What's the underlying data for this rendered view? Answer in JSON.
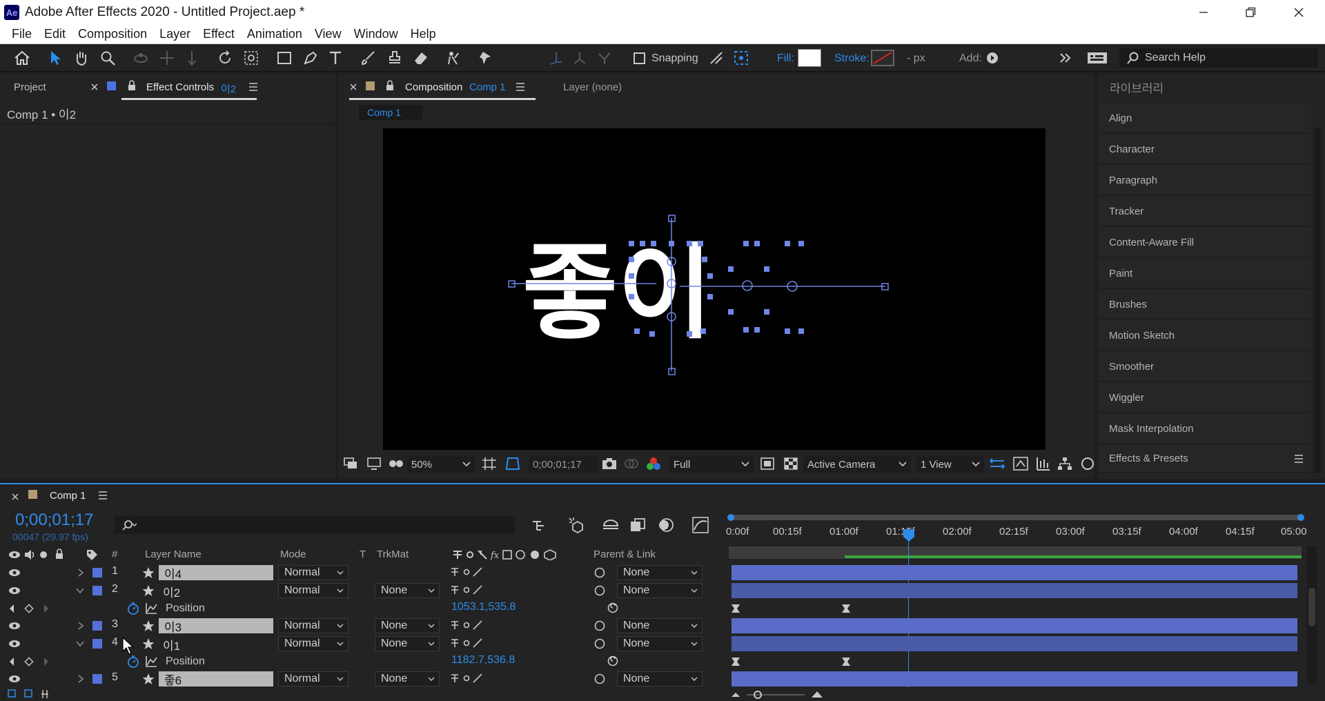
{
  "window": {
    "title": "Adobe After Effects 2020 - Untitled Project.aep *",
    "app_badge": "Ae"
  },
  "menu": [
    "File",
    "Edit",
    "Composition",
    "Layer",
    "Effect",
    "Animation",
    "View",
    "Window",
    "Help"
  ],
  "toolbar": {
    "snapping": "Snapping",
    "fill": "Fill:",
    "stroke": "Stroke:",
    "px": "- px",
    "add": "Add:",
    "search_placeholder": "Search Help"
  },
  "left_panel": {
    "tab_project": "Project",
    "tab_effect_controls": "Effect Controls",
    "effect_target": "이2",
    "breadcrumb": "Comp 1 • 이2"
  },
  "comp_panel": {
    "tab_label": "Composition",
    "comp_name": "Comp 1",
    "layer_tab": "Layer (none)",
    "sub_tab": "Comp 1",
    "viewer_text": "좋이",
    "zoom": "50%",
    "timecode": "0;00;01;17",
    "resolution": "Full",
    "camera": "Active Camera",
    "views": "1 View"
  },
  "right_panel": {
    "library": "라이브러리",
    "items": [
      "Align",
      "Character",
      "Paragraph",
      "Tracker",
      "Content-Aware Fill",
      "Paint",
      "Brushes",
      "Motion Sketch",
      "Smoother",
      "Wiggler",
      "Mask Interpolation",
      "Effects & Presets"
    ]
  },
  "timeline": {
    "tab_label": "Comp 1",
    "timecode": "0;00;01;17",
    "frame_info": "00047 (29.97 fps)",
    "columns": {
      "num": "#",
      "layer_name": "Layer Name",
      "mode": "Mode",
      "t": "T",
      "trkmat": "TrkMat",
      "parent": "Parent & Link"
    },
    "ruler": [
      "0:00f",
      "00:15f",
      "01:00f",
      "01:15f",
      "02:00f",
      "02:15f",
      "03:00f",
      "03:15f",
      "04:00f",
      "04:15f",
      "05:00"
    ],
    "layers": [
      {
        "num": "1",
        "name": "이4",
        "mode": "Normal",
        "trkmat": "",
        "parent": "None"
      },
      {
        "num": "2",
        "name": "이2",
        "mode": "Normal",
        "trkmat": "None",
        "parent": "None"
      },
      {
        "num": "3",
        "name": "이3",
        "mode": "Normal",
        "trkmat": "None",
        "parent": "None"
      },
      {
        "num": "4",
        "name": "이1",
        "mode": "Normal",
        "trkmat": "None",
        "parent": "None"
      },
      {
        "num": "5",
        "name": "좋6",
        "mode": "Normal",
        "trkmat": "None",
        "parent": "None"
      }
    ],
    "position_rows": [
      {
        "label": "Position",
        "value": "1053.1,535.8"
      },
      {
        "label": "Position",
        "value": "1182.7,536.8"
      }
    ]
  },
  "colors": {
    "accent": "#2d8ceb",
    "layer_label": "#5570d8",
    "track": "#5a6cc8",
    "work_area": "#3aa63a"
  }
}
